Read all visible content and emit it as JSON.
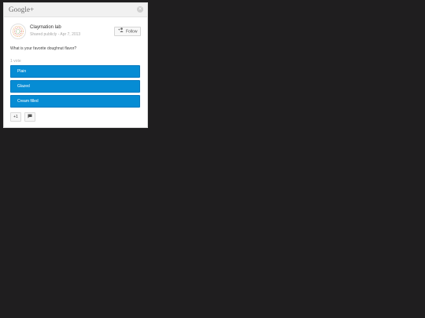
{
  "header": {
    "brand": "Google+",
    "close_icon": "close-icon"
  },
  "post": {
    "author": "Claymation lab",
    "meta": "Shared publicly  -  Apr 7, 2013",
    "follow_label": "Follow",
    "question": "What is your favorite doughnut flavor?",
    "vote_count": "1 vote",
    "options": [
      {
        "label": "Plain"
      },
      {
        "label": "Glazed"
      },
      {
        "label": "Cream filled"
      }
    ],
    "plus_label": "+1",
    "option_color": "#068cd4"
  }
}
